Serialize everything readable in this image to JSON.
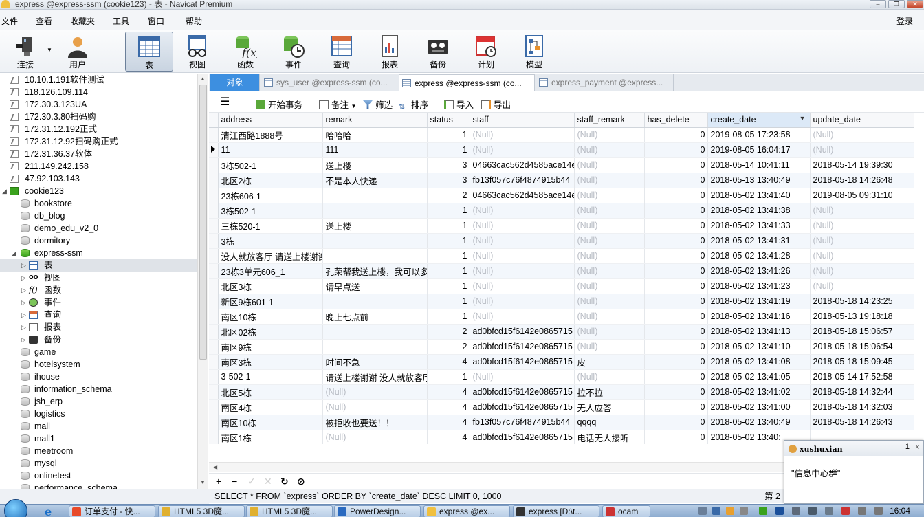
{
  "window": {
    "title": "express @express-ssm (cookie123) - 表 - Navicat Premium",
    "login": "登录"
  },
  "menu": [
    "文件",
    "查看",
    "收藏夹",
    "工具",
    "窗口",
    "帮助"
  ],
  "toolbar": {
    "buttons": [
      {
        "label": "连接",
        "icon": "plug-icon"
      },
      {
        "label": "用户",
        "icon": "user-icon"
      },
      {
        "label": "表",
        "icon": "table-icon",
        "active": true
      },
      {
        "label": "视图",
        "icon": "view-icon"
      },
      {
        "label": "函数",
        "icon": "function-icon"
      },
      {
        "label": "事件",
        "icon": "event-icon"
      },
      {
        "label": "查询",
        "icon": "query-icon"
      },
      {
        "label": "报表",
        "icon": "report-icon"
      },
      {
        "label": "备份",
        "icon": "backup-icon"
      },
      {
        "label": "计划",
        "icon": "schedule-icon"
      },
      {
        "label": "模型",
        "icon": "model-icon"
      }
    ]
  },
  "sidebar": {
    "connections": [
      "10.10.1.191软件测试",
      "118.126.109.114",
      "172.30.3.123UA",
      "172.30.3.80扫码购",
      "172.31.12.192正式",
      "172.31.12.92扫码购正式",
      "172.31.36.37软体",
      "211.149.242.158",
      "47.92.103.143"
    ],
    "open_connection": "cookie123",
    "databases_before": [
      "bookstore",
      "db_blog",
      "demo_edu_v2_0",
      "dormitory"
    ],
    "open_database": "express-ssm",
    "db_children": [
      "表",
      "视图",
      "函数",
      "事件",
      "查询",
      "报表",
      "备份"
    ],
    "databases_after": [
      "game",
      "hotelsystem",
      "ihouse",
      "information_schema",
      "jsh_erp",
      "logistics",
      "mall",
      "mall1",
      "meetroom",
      "mysql",
      "onlinetest",
      "performance_schema"
    ]
  },
  "tabs": {
    "object": "对象",
    "items": [
      "sys_user @express-ssm (co...",
      "express @express-ssm (co...",
      "express_payment @express..."
    ]
  },
  "gridtools": {
    "menu": "",
    "begin_tx": "开始事务",
    "memo": "备注",
    "filter": "筛选",
    "sort": "排序",
    "import": "导入",
    "export": "导出"
  },
  "grid": {
    "columns": [
      "address",
      "remark",
      "status",
      "staff",
      "staff_remark",
      "has_delete",
      "create_date",
      "update_date"
    ],
    "rows": [
      [
        "清江西路1888号",
        "哈哈哈",
        "1",
        "(Null)",
        "(Null)",
        "0",
        "2019-08-05 17:23:58",
        "(Null)"
      ],
      [
        "11",
        "111",
        "1",
        "(Null)",
        "(Null)",
        "0",
        "2019-08-05 16:04:17",
        "(Null)"
      ],
      [
        "3栋502-1",
        "送上楼",
        "3",
        "04663cac562d4585ace14e",
        "(Null)",
        "0",
        "2018-05-14 10:41:11",
        "2018-05-14 19:39:30"
      ],
      [
        "北区2栋",
        "不是本人快递",
        "3",
        "fb13f057c76f4874915b44",
        "(Null)",
        "0",
        "2018-05-13 13:40:49",
        "2018-05-18 14:26:48"
      ],
      [
        "23栋606-1",
        "",
        "2",
        "04663cac562d4585ace14e",
        "(Null)",
        "0",
        "2018-05-02 13:41:40",
        "2019-08-05 09:31:10"
      ],
      [
        "3栋502-1",
        "",
        "1",
        "(Null)",
        "(Null)",
        "0",
        "2018-05-02 13:41:38",
        "(Null)"
      ],
      [
        "三栋520-1",
        "送上楼",
        "1",
        "(Null)",
        "(Null)",
        "0",
        "2018-05-02 13:41:33",
        "(Null)"
      ],
      [
        "3栋",
        "",
        "1",
        "(Null)",
        "(Null)",
        "0",
        "2018-05-02 13:41:31",
        "(Null)"
      ],
      [
        "没人就放客厅 请送上楼谢谢",
        "",
        "1",
        "(Null)",
        "(Null)",
        "0",
        "2018-05-02 13:41:28",
        "(Null)"
      ],
      [
        "23栋3单元606_1",
        "孔荣帮我送上楼，我可以多给钱",
        "1",
        "(Null)",
        "(Null)",
        "0",
        "2018-05-02 13:41:26",
        "(Null)"
      ],
      [
        "北区3栋",
        "请早点送",
        "1",
        "(Null)",
        "(Null)",
        "0",
        "2018-05-02 13:41:23",
        "(Null)"
      ],
      [
        "新区9栋601-1",
        "",
        "1",
        "(Null)",
        "(Null)",
        "0",
        "2018-05-02 13:41:19",
        "2018-05-18 14:23:25"
      ],
      [
        "南区10栋",
        "晚上七点前",
        "1",
        "(Null)",
        "(Null)",
        "0",
        "2018-05-02 13:41:16",
        "2018-05-13 19:18:18"
      ],
      [
        "北区02栋",
        "",
        "2",
        "ad0bfcd15f6142e0865715",
        "(Null)",
        "0",
        "2018-05-02 13:41:13",
        "2018-05-18 15:06:57"
      ],
      [
        "南区9栋",
        "",
        "2",
        "ad0bfcd15f6142e0865715",
        "(Null)",
        "0",
        "2018-05-02 13:41:10",
        "2018-05-18 15:06:54"
      ],
      [
        "南区3栋",
        "时间不急",
        "4",
        "ad0bfcd15f6142e0865715",
        "皮",
        "0",
        "2018-05-02 13:41:08",
        "2018-05-18 15:09:45"
      ],
      [
        "3-502-1",
        "请送上楼谢谢 没人就放客厅",
        "1",
        "(Null)",
        "(Null)",
        "0",
        "2018-05-02 13:41:05",
        "2018-05-14 17:52:58"
      ],
      [
        "北区5栋",
        "(Null)",
        "4",
        "ad0bfcd15f6142e0865715",
        "拉不拉",
        "0",
        "2018-05-02 13:41:02",
        "2018-05-18 14:32:44"
      ],
      [
        "南区4栋",
        "(Null)",
        "4",
        "ad0bfcd15f6142e0865715",
        "无人应答",
        "0",
        "2018-05-02 13:41:00",
        "2018-05-18 14:32:03"
      ],
      [
        "南区10栋",
        "被拒收也要送！！",
        "4",
        "fb13f057c76f4874915b44",
        "qqqq",
        "0",
        "2018-05-02 13:40:49",
        "2018-05-18 14:26:43"
      ],
      [
        "南区1栋",
        "(Null)",
        "4",
        "ad0bfcd15f6142e0865715",
        "电话无人接听",
        "0",
        "2018-05-02 13:40:",
        ""
      ]
    ]
  },
  "status": {
    "sql": "SELECT * FROM `express` ORDER BY `create_date` DESC LIMIT 0, 1000",
    "page": "第 2"
  },
  "popup": {
    "name": "xushuxian",
    "count": "1",
    "close": "×",
    "message": "\"信息中心群\""
  },
  "taskbar": {
    "tasks": [
      "订单支付 - 快...",
      "HTML5 3D魔...",
      "HTML5 3D魔...",
      "PowerDesign...",
      "express @ex...",
      "express [D:\\t...",
      "ocam"
    ],
    "clock": "16:04"
  },
  "colors": {
    "accent": "#3d8fe0",
    "null_text": "#b8bcc4",
    "alt_row": "#f3f7fc"
  }
}
